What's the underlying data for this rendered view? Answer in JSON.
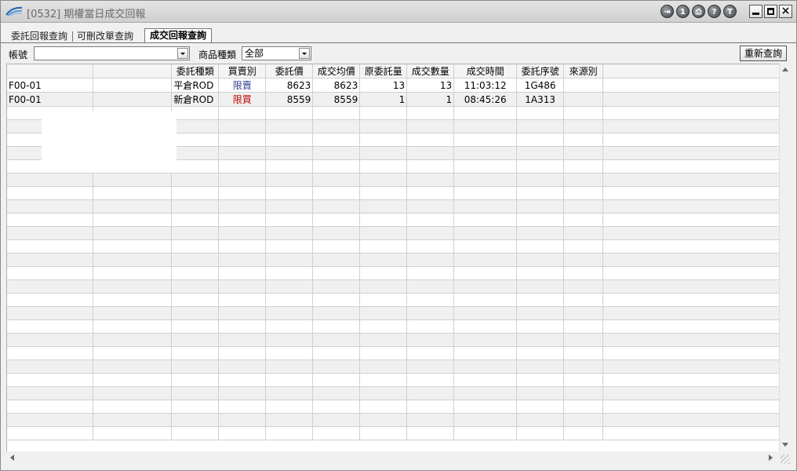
{
  "window": {
    "title": "[0532] 期權當日成交回報",
    "icons": [
      "exit-icon",
      "info-icon",
      "print-icon",
      "help-icon",
      "pin-icon"
    ],
    "icon_glyphs": [
      "⇥",
      "1",
      "⎙",
      "?",
      "T"
    ]
  },
  "tabs": [
    {
      "label": "委託回報查詢",
      "active": false
    },
    {
      "label": "可刪改單查詢",
      "active": false
    },
    {
      "label": "成交回報查詢",
      "active": true
    }
  ],
  "toolbar": {
    "account_label": "帳號",
    "account_value": "",
    "product_label": "商品種類",
    "product_value": "全部",
    "requery_label": "重新查詢"
  },
  "table": {
    "columns": [
      "",
      "",
      "委託種類",
      "買賣別",
      "委託價",
      "成交均價",
      "原委託量",
      "成交數量",
      "成交時間",
      "委託序號",
      "來源別",
      ""
    ],
    "rows": [
      [
        "F00-01",
        "",
        "平倉ROD",
        "限賣",
        "8623",
        "8623",
        "13",
        "13",
        "11:03:12",
        "1G486",
        "",
        ""
      ],
      [
        "F00-01",
        "",
        "新倉ROD",
        "限買",
        "8559",
        "8559",
        "1",
        "1",
        "08:45:26",
        "1A313",
        "",
        ""
      ]
    ]
  },
  "colors": {
    "sell_text": "#2b3a8c",
    "buy_text": "#c00000",
    "accent_blue": "#1f5fb5"
  }
}
